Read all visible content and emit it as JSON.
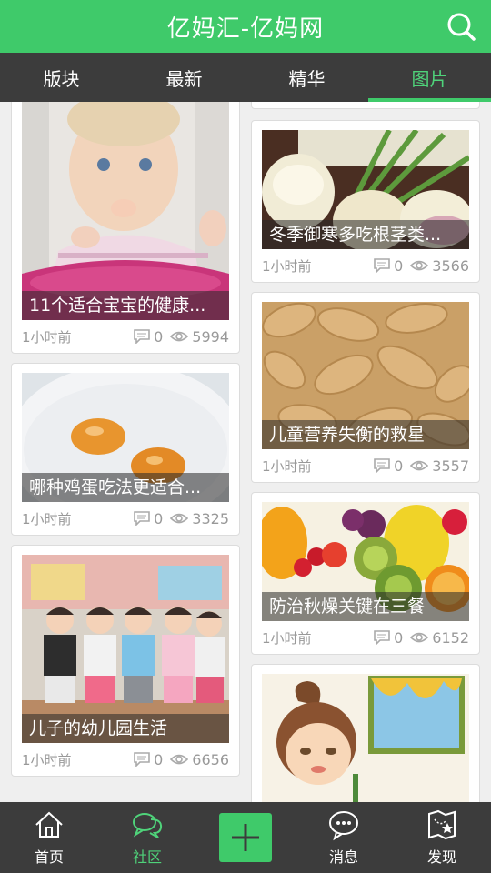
{
  "header": {
    "title": "亿妈汇-亿妈网",
    "search_icon": "search-icon"
  },
  "tabs": [
    {
      "label": "版块"
    },
    {
      "label": "最新"
    },
    {
      "label": "精华"
    },
    {
      "label": "图片",
      "active": true
    }
  ],
  "left_cards": [
    {
      "caption": "11个适合宝宝的健康...",
      "time": "1小时前",
      "comments": "0",
      "views": "5994",
      "image": "baby-eating"
    },
    {
      "caption": "哪种鸡蛋吃法更适合...",
      "time": "1小时前",
      "comments": "0",
      "views": "3325",
      "image": "eggs"
    },
    {
      "caption": "儿子的幼儿园生活",
      "time": "1小时前",
      "comments": "0",
      "views": "6656",
      "image": "kindergarten"
    }
  ],
  "right_cards": [
    {
      "caption": "冬季御寒多吃根茎类...",
      "time": "1小时前",
      "comments": "0",
      "views": "3566",
      "image": "turnips"
    },
    {
      "caption": "儿童营养失衡的救星",
      "time": "1小时前",
      "comments": "0",
      "views": "3557",
      "image": "peanuts"
    },
    {
      "caption": "防治秋燥关键在三餐",
      "time": "1小时前",
      "comments": "0",
      "views": "6152",
      "image": "fruits"
    },
    {
      "caption": "",
      "time": "",
      "comments": "",
      "views": "",
      "image": "cartoon-girl"
    }
  ],
  "bottom_nav": [
    {
      "label": "首页",
      "icon": "home-icon"
    },
    {
      "label": "社区",
      "icon": "community-icon",
      "active": true
    },
    {
      "label": "",
      "icon": "add-icon"
    },
    {
      "label": "消息",
      "icon": "message-icon"
    },
    {
      "label": "发现",
      "icon": "map-icon"
    }
  ],
  "colors": {
    "accent": "#3fca6a",
    "bar": "#3c3c3c",
    "active_text": "#4fd37a"
  }
}
